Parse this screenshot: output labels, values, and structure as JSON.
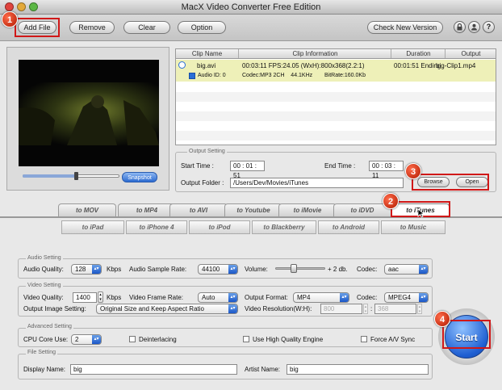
{
  "window": {
    "title": "MacX Video Converter Free Edition"
  },
  "toolbar": {
    "add_file": "Add File",
    "remove": "Remove",
    "clear": "Clear",
    "option": "Option",
    "check_version": "Check New Version",
    "icons": [
      "lock-icon",
      "user-icon",
      "help-icon"
    ],
    "help_glyph": "?"
  },
  "badges": [
    "1",
    "2",
    "3",
    "4"
  ],
  "preview": {
    "snapshot": "Snapshot",
    "slider_position": 0.55
  },
  "table": {
    "headers": [
      "Clip Name",
      "Clip Information",
      "Duration",
      "Output"
    ],
    "row": {
      "name": "big.avi",
      "info": "00:03:11  FPS:24.05  (WxH):800x368(2.2:1)",
      "duration": "00:01:51 Ending",
      "output": "big-Clip1.mp4",
      "audio_id": "Audio ID: 0",
      "audio_info": "Codec:MP3 2CH    44.1KHz",
      "bitrate": "BitRate:160.0Kb"
    }
  },
  "output_setting": {
    "title": "Output Setting",
    "start_label": "Start Time :",
    "start_value": "00 : 01 : 51",
    "end_label": "End Time :",
    "end_value": "00 : 03 : 11",
    "folder_label": "Output Folder :",
    "folder_value": "/Users/Dev/Movies/iTunes",
    "browse": "Browse",
    "open": "Open"
  },
  "tabs": [
    "to MOV",
    "to MP4",
    "to AVI",
    "to Youtube",
    "to iMovie",
    "to iDVD",
    "to iTunes"
  ],
  "active_tab": "to iTunes",
  "subtabs": [
    "to iPad",
    "to iPhone 4",
    "to iPod",
    "to Blackberry",
    "to Android",
    "to Music"
  ],
  "audio": {
    "title": "Audio Setting",
    "quality_label": "Audio Quality:",
    "quality_value": "128",
    "kbps": "Kbps",
    "sample_label": "Audio Sample Rate:",
    "sample_value": "44100",
    "volume_label": "Volume:",
    "volume_text": "+ 2 db.",
    "volume_level": 0.35,
    "codec_label": "Codec:",
    "codec_value": "aac"
  },
  "video": {
    "title": "Video Setting",
    "quality_label": "Video Quality:",
    "quality_value": "1400",
    "kbps": "Kbps",
    "frame_label": "Video Frame Rate:",
    "frame_value": "Auto",
    "format_label": "Output Format:",
    "format_value": "MP4",
    "codec_label": "Codec:",
    "codec_value": "MPEG4",
    "image_label": "Output Image Setting:",
    "image_value": "Original Size and Keep Aspect Ratio",
    "resolution_label": "Video Resolution(W:H):",
    "res_w": "800",
    "res_h": "368",
    "res_sep": ":"
  },
  "advanced": {
    "title": "Advanced Setting",
    "cpu_label": "CPU Core Use:",
    "cpu_value": "2",
    "deinterlacing": "Deinterlacing",
    "high_quality": "Use High Quality Engine",
    "force_av": "Force A/V Sync"
  },
  "file_setting": {
    "title": "File Setting",
    "display_label": "Display Name:",
    "display_value": "big",
    "artist_label": "Artist Name:",
    "artist_value": "big"
  },
  "start_button": "Start",
  "colors": {
    "accent_blue": "#2a6fd6",
    "highlight_row": "#eef0b8",
    "badge_red": "#c8290a",
    "marker_red": "#d01818"
  }
}
